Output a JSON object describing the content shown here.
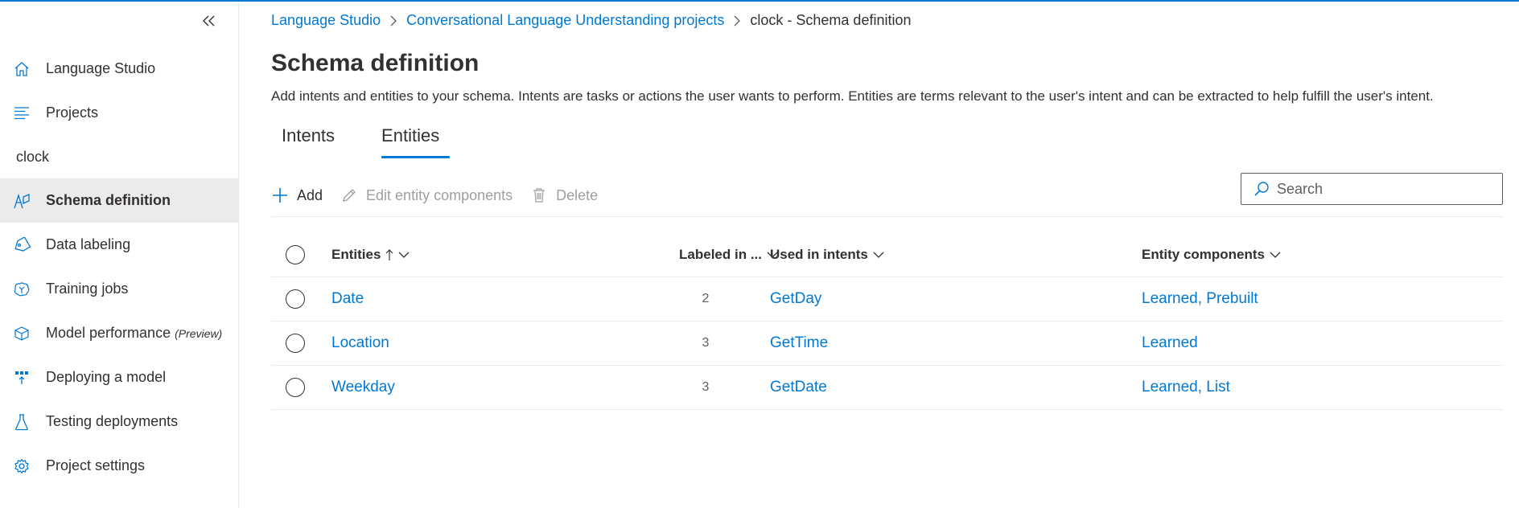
{
  "breadcrumb": {
    "items": [
      "Language Studio",
      "Conversational Language Understanding projects"
    ],
    "current": "clock - Schema definition"
  },
  "sidebar": {
    "top_items": [
      {
        "label": "Language Studio",
        "icon": "home-icon"
      },
      {
        "label": "Projects",
        "icon": "list-icon"
      }
    ],
    "project_name": "clock",
    "project_items": [
      {
        "label": "Schema definition",
        "icon": "schema-icon",
        "selected": true
      },
      {
        "label": "Data labeling",
        "icon": "tag-icon"
      },
      {
        "label": "Training jobs",
        "icon": "brain-icon"
      },
      {
        "label": "Model performance",
        "sub": "(Preview)",
        "icon": "cube-icon"
      },
      {
        "label": "Deploying a model",
        "icon": "deploy-icon"
      },
      {
        "label": "Testing deployments",
        "icon": "flask-icon"
      },
      {
        "label": "Project settings",
        "icon": "gear-icon"
      }
    ]
  },
  "page": {
    "title": "Schema definition",
    "description": "Add intents and entities to your schema. Intents are tasks or actions the user wants to perform. Entities are terms relevant to the user's intent and can be extracted to help fulfill the user's intent."
  },
  "tabs": [
    {
      "label": "Intents",
      "active": false
    },
    {
      "label": "Entities",
      "active": true
    }
  ],
  "toolbar": {
    "add": "Add",
    "edit": "Edit entity components",
    "delete": "Delete",
    "search_placeholder": "Search"
  },
  "table": {
    "columns": {
      "entities": "Entities",
      "labeled": "Labeled in ...",
      "intents": "Used in intents",
      "components": "Entity components"
    },
    "rows": [
      {
        "entity": "Date",
        "labeled": "2",
        "intents": "GetDay",
        "components": "Learned, Prebuilt"
      },
      {
        "entity": "Location",
        "labeled": "3",
        "intents": "GetTime",
        "components": "Learned"
      },
      {
        "entity": "Weekday",
        "labeled": "3",
        "intents": "GetDate",
        "components": "Learned, List"
      }
    ]
  },
  "colors": {
    "accent": "#0078d4",
    "text": "#323130",
    "selected_bg": "#edebe9",
    "disabled": "#a19f9d"
  }
}
